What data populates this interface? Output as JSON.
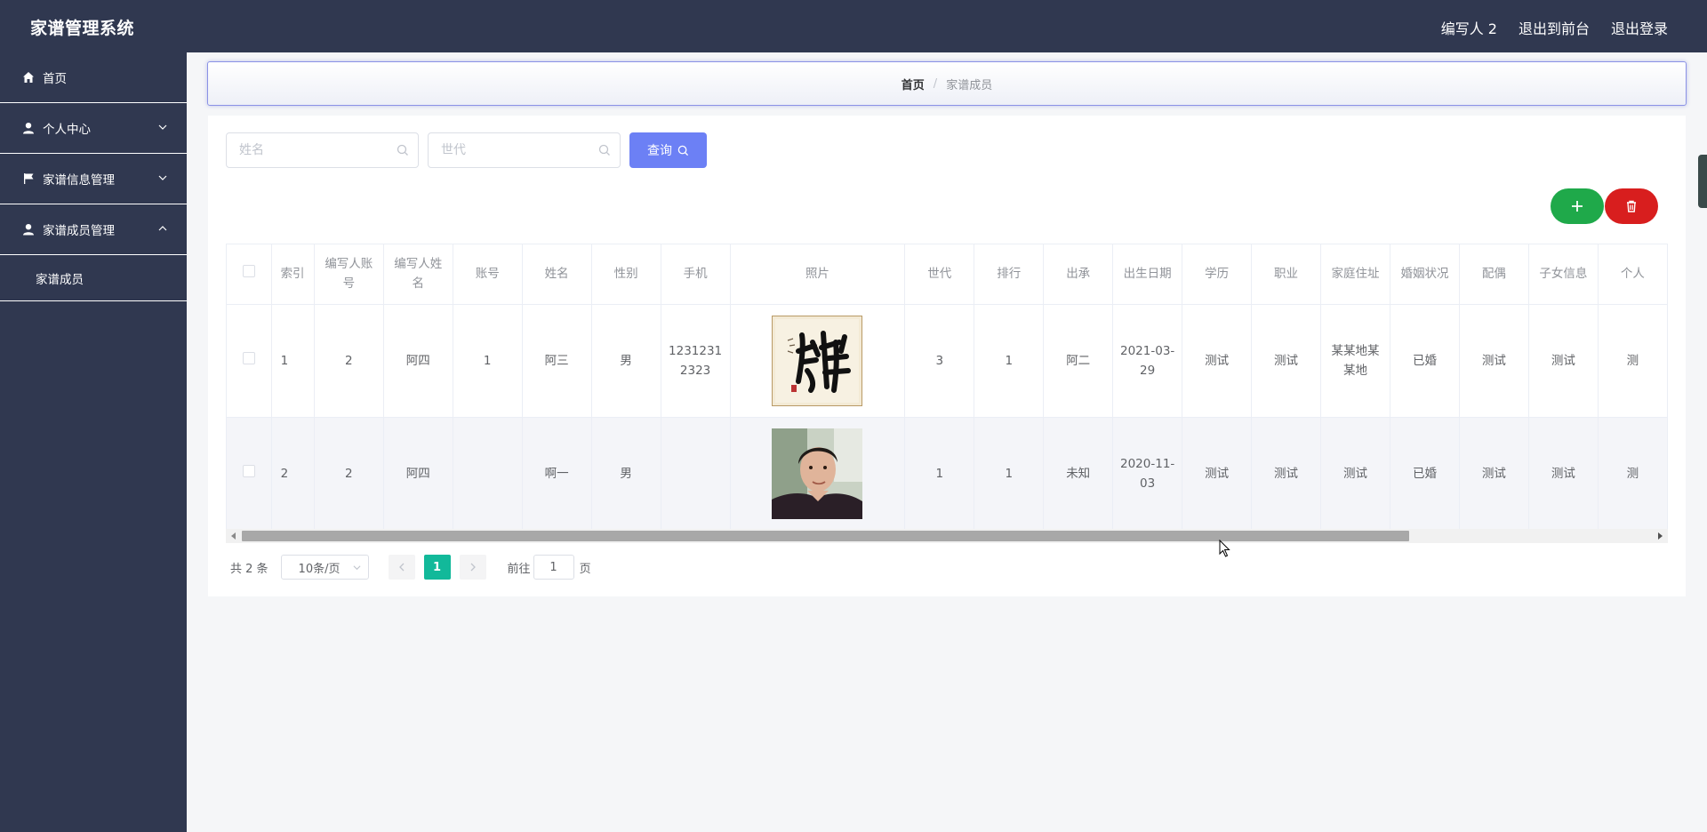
{
  "app": {
    "title": "家谱管理系统"
  },
  "topnav": {
    "user": "编写人 2",
    "to_front": "退出到前台",
    "logout": "退出登录"
  },
  "sidebar": {
    "items": [
      {
        "label": "首页",
        "icon": "home-icon"
      },
      {
        "label": "个人中心",
        "icon": "person-icon"
      },
      {
        "label": "家谱信息管理",
        "icon": "flag-icon"
      },
      {
        "label": "家谱成员管理",
        "icon": "person-icon"
      }
    ],
    "sub_items": [
      {
        "label": "家谱成员"
      }
    ]
  },
  "breadcrumb": {
    "home": "首页",
    "sep": "/",
    "current": "家谱成员"
  },
  "search": {
    "name_placeholder": "姓名",
    "generation_placeholder": "世代",
    "query_label": "查询"
  },
  "table": {
    "headers": [
      "索引",
      "编写人账号",
      "编写人姓名",
      "账号",
      "姓名",
      "性别",
      "手机",
      "照片",
      "世代",
      "排行",
      "出承",
      "出生日期",
      "学历",
      "职业",
      "家庭住址",
      "婚姻状况",
      "配偶",
      "子女信息",
      "个人"
    ],
    "rows": [
      {
        "index": "1",
        "writer_account": "2",
        "writer_name": "阿四",
        "account": "1",
        "name": "阿三",
        "gender": "男",
        "phone": "12312312323",
        "photo": "calligraphy-image",
        "generation": "3",
        "rank": "1",
        "chucheng": "阿二",
        "birth": "2021-03-29",
        "education": "测试",
        "job": "测试",
        "address": "某某地某某地",
        "marital": "已婚",
        "spouse": "测试",
        "children": "测试",
        "personal": "测"
      },
      {
        "index": "2",
        "writer_account": "2",
        "writer_name": "阿四",
        "account": "",
        "name": "啊一",
        "gender": "男",
        "phone": "",
        "photo": "portrait-image",
        "generation": "1",
        "rank": "1",
        "chucheng": "未知",
        "birth": "2020-11-03",
        "education": "测试",
        "job": "测试",
        "address": "测试",
        "marital": "已婚",
        "spouse": "测试",
        "children": "测试",
        "personal": "测"
      }
    ]
  },
  "pagination": {
    "total": "共 2 条",
    "page_size": "10条/页",
    "current_page": "1",
    "goto_label": "前往",
    "goto_value": "1",
    "page_suffix": "页"
  },
  "colors": {
    "header_bg": "#303850",
    "primary": "#6c80f5",
    "add": "#1fa94a",
    "delete": "#d81e1e",
    "page_active": "#12b99a"
  }
}
